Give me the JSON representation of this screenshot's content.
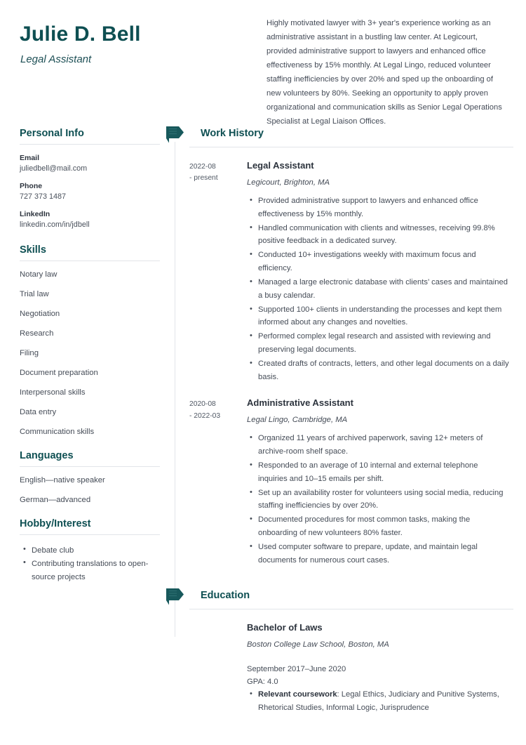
{
  "theme": {
    "accent": "#0e4f52",
    "text": "#454c57",
    "heading_text": "#2c333d",
    "rule": "#e2e5e9"
  },
  "header": {
    "name": "Julie D. Bell",
    "job_title": "Legal Assistant",
    "summary": "Highly motivated lawyer with 3+ year's experience working as an administrative assistant in a bustling law center. At Legicourt, provided administrative support to lawyers and enhanced office effectiveness by 15% monthly. At Legal Lingo, reduced volunteer staffing inefficiencies by over 20% and sped up the onboarding of new volunteers by 80%. Seeking an opportunity to apply proven organizational and communication skills as Senior Legal Operations Specialist at Legal Liaison Offices."
  },
  "sidebar": {
    "personal_info": {
      "heading": "Personal Info",
      "items": [
        {
          "label": "Email",
          "value": "juliedbell@mail.com"
        },
        {
          "label": "Phone",
          "value": "727 373 1487"
        },
        {
          "label": "LinkedIn",
          "value": "linkedin.com/in/jdbell"
        }
      ]
    },
    "skills": {
      "heading": "Skills",
      "items": [
        "Notary law",
        "Trial law",
        "Negotiation",
        "Research",
        "Filing",
        "Document preparation",
        "Interpersonal skills",
        "Data entry",
        "Communication skills"
      ]
    },
    "languages": {
      "heading": "Languages",
      "items": [
        "English—native speaker",
        "German—advanced"
      ]
    },
    "hobby": {
      "heading": "Hobby/Interest",
      "items": [
        "Debate club",
        "Contributing translations to open-source projects"
      ]
    }
  },
  "work_history": {
    "heading": "Work History",
    "icon": "flag-icon",
    "entries": [
      {
        "date_start": "2022-08",
        "date_end": "- present",
        "title": "Legal Assistant",
        "org": "Legicourt, Brighton, MA",
        "bullets": [
          "Provided administrative support to lawyers and enhanced office effectiveness by 15% monthly.",
          "Handled communication with clients and witnesses, receiving 99.8% positive feedback in a dedicated survey.",
          "Conducted 10+ investigations weekly with maximum focus and efficiency.",
          "Managed a large electronic database with clients’ cases and maintained a busy calendar.",
          "Supported 100+ clients in understanding the processes and kept them informed about any changes and novelties.",
          "Performed complex legal research and assisted with reviewing and preserving legal documents.",
          "Created drafts of contracts, letters, and other legal documents on a daily basis."
        ]
      },
      {
        "date_start": "2020-08",
        "date_end": "- 2022-03",
        "title": "Administrative Assistant",
        "org": "Legal Lingo, Cambridge, MA",
        "bullets": [
          "Organized 11 years of archived paperwork, saving 12+ meters of archive-room shelf space.",
          "Responded to an average of 10 internal and external telephone inquiries and 10–15 emails per shift.",
          "Set up an availability roster for volunteers using social media, reducing staffing inefficiencies by over 20%.",
          "Documented procedures for most common tasks, making the onboarding of new volunteers 80% faster.",
          "Used computer software to prepare, update, and maintain legal documents for numerous court cases."
        ]
      }
    ]
  },
  "education": {
    "heading": "Education",
    "icon": "flag-icon",
    "entries": [
      {
        "degree": "Bachelor of Laws",
        "school": "Boston College Law School, Boston, MA",
        "dates": "September 2017–June 2020",
        "gpa": "GPA: 4.0",
        "coursework_label": "Relevant coursework",
        "coursework_value": ": Legal Ethics, Judiciary and Punitive Systems, Rhetorical Studies, Informal Logic, Jurisprudence"
      }
    ]
  }
}
